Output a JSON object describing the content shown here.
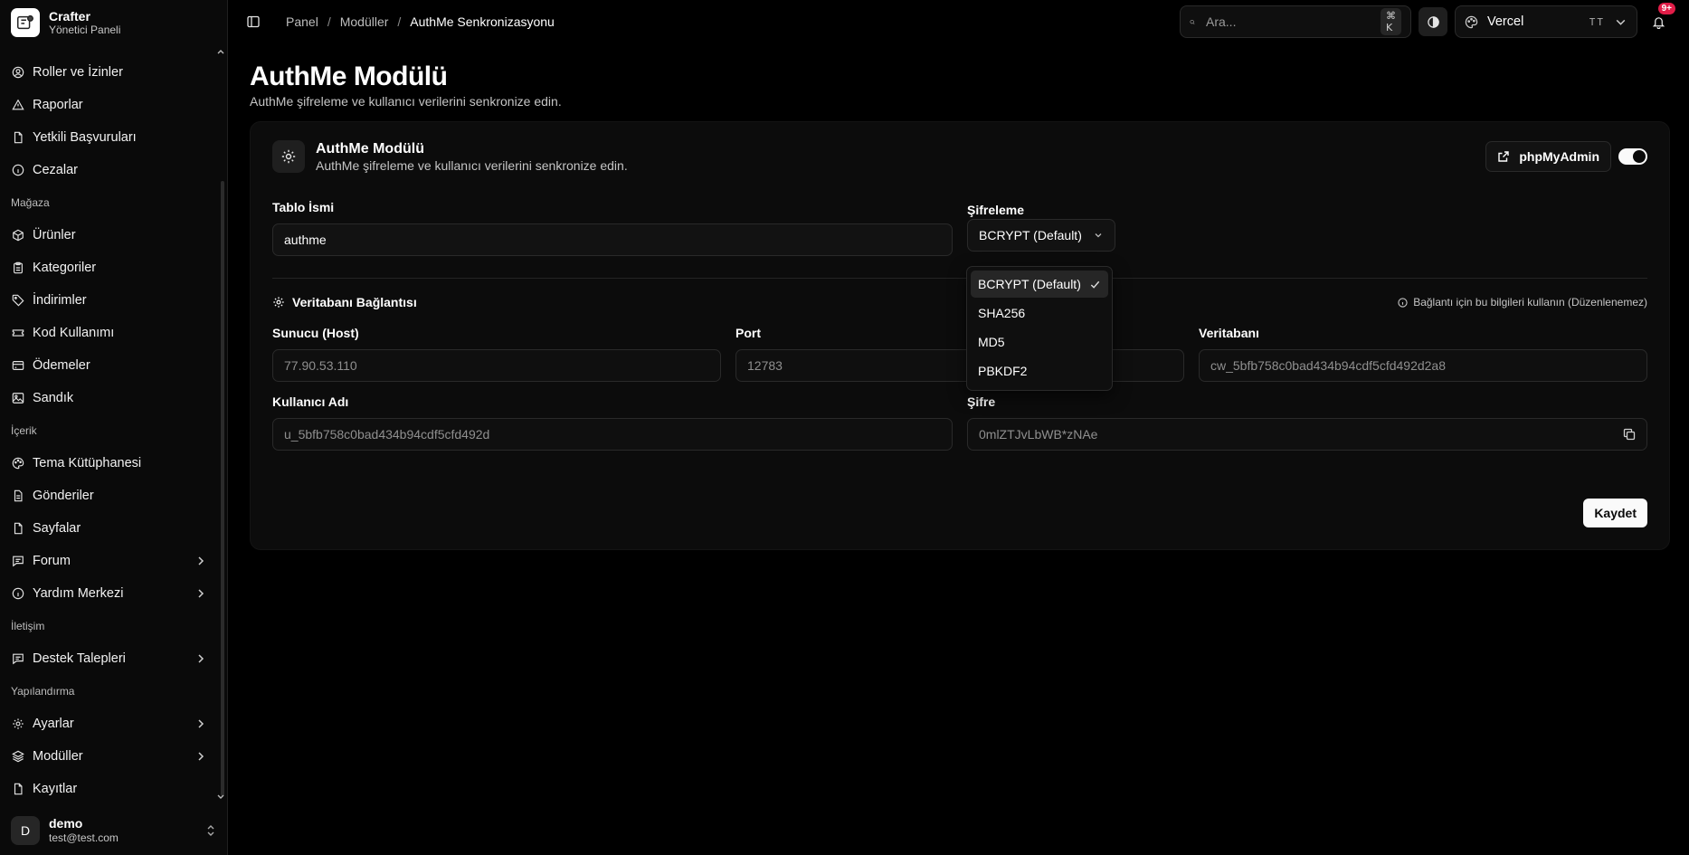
{
  "brand": {
    "name": "Crafter",
    "subtitle": "Yönetici Paneli"
  },
  "sidebar": {
    "items": [
      {
        "label": "Roller ve İzinler",
        "icon": "user-circle-icon"
      },
      {
        "label": "Raporlar",
        "icon": "alert-triangle-icon"
      },
      {
        "label": "Yetkili Başvuruları",
        "icon": "file-icon"
      },
      {
        "label": "Cezalar",
        "icon": "info-circle-icon"
      }
    ],
    "group_store": "Mağaza",
    "store_items": [
      {
        "label": "Ürünler",
        "icon": "package-icon"
      },
      {
        "label": "Kategoriler",
        "icon": "clipboard-icon"
      },
      {
        "label": "İndirimler",
        "icon": "tag-icon"
      },
      {
        "label": "Kod Kullanımı",
        "icon": "ticket-icon"
      },
      {
        "label": "Ödemeler",
        "icon": "credit-card-icon"
      },
      {
        "label": "Sandık",
        "icon": "image-icon"
      }
    ],
    "group_content": "İçerik",
    "content_items": [
      {
        "label": "Tema Kütüphanesi",
        "icon": "palette-icon"
      },
      {
        "label": "Gönderiler",
        "icon": "document-icon"
      },
      {
        "label": "Sayfalar",
        "icon": "file-icon"
      },
      {
        "label": "Forum",
        "icon": "message-square-icon"
      },
      {
        "label": "Yardım Merkezi",
        "icon": "info-circle-icon"
      }
    ],
    "group_contact": "İletişim",
    "contact_items": [
      {
        "label": "Destek Talepleri",
        "icon": "message-square-icon"
      }
    ],
    "group_config": "Yapılandırma",
    "config_items": [
      {
        "label": "Ayarlar",
        "icon": "gear-icon"
      },
      {
        "label": "Modüller",
        "icon": "layers-icon"
      },
      {
        "label": "Kayıtlar",
        "icon": "file-icon"
      }
    ]
  },
  "user": {
    "initial": "D",
    "name": "demo",
    "email": "test@test.com"
  },
  "topbar": {
    "breadcrumb": [
      "Panel",
      "Modüller",
      "AuthMe Senkronizasyonu"
    ],
    "search_placeholder": "Ara...",
    "search_shortcut": "⌘ K",
    "team_name": "Vercel",
    "team_initials": "TT",
    "notification_count": "9+"
  },
  "page": {
    "title": "AuthMe Modülü",
    "subtitle": "AuthMe şifreleme ve kullanıcı verilerini senkronize edin."
  },
  "card": {
    "title": "AuthMe Modülü",
    "subtitle": "AuthMe şifreleme ve kullanıcı verilerini senkronize edin.",
    "phpmyadmin_label": "phpMyAdmin",
    "enabled": true,
    "table_name_label": "Tablo İsmi",
    "table_name_value": "authme",
    "encryption_label": "Şifreleme",
    "encryption_value": "BCRYPT (Default)",
    "encryption_options": [
      "BCRYPT (Default)",
      "SHA256",
      "MD5",
      "PBKDF2"
    ],
    "db_section_title": "Veritabanı Bağlantısı",
    "db_section_note": "Bağlantı için bu bilgileri kullanın (Düzenlenemez)",
    "host_label": "Sunucu (Host)",
    "host_value": "77.90.53.110",
    "port_label": "Port",
    "port_value": "12783",
    "database_label": "Veritabanı",
    "database_value": "cw_5bfb758c0bad434b94cdf5cfd492d2a8",
    "username_label": "Kullanıcı Adı",
    "username_value": "u_5bfb758c0bad434b94cdf5cfd492d",
    "password_label": "Şifre",
    "password_value": "0mlZTJvLbWB*zNAe",
    "save_label": "Kaydet"
  }
}
